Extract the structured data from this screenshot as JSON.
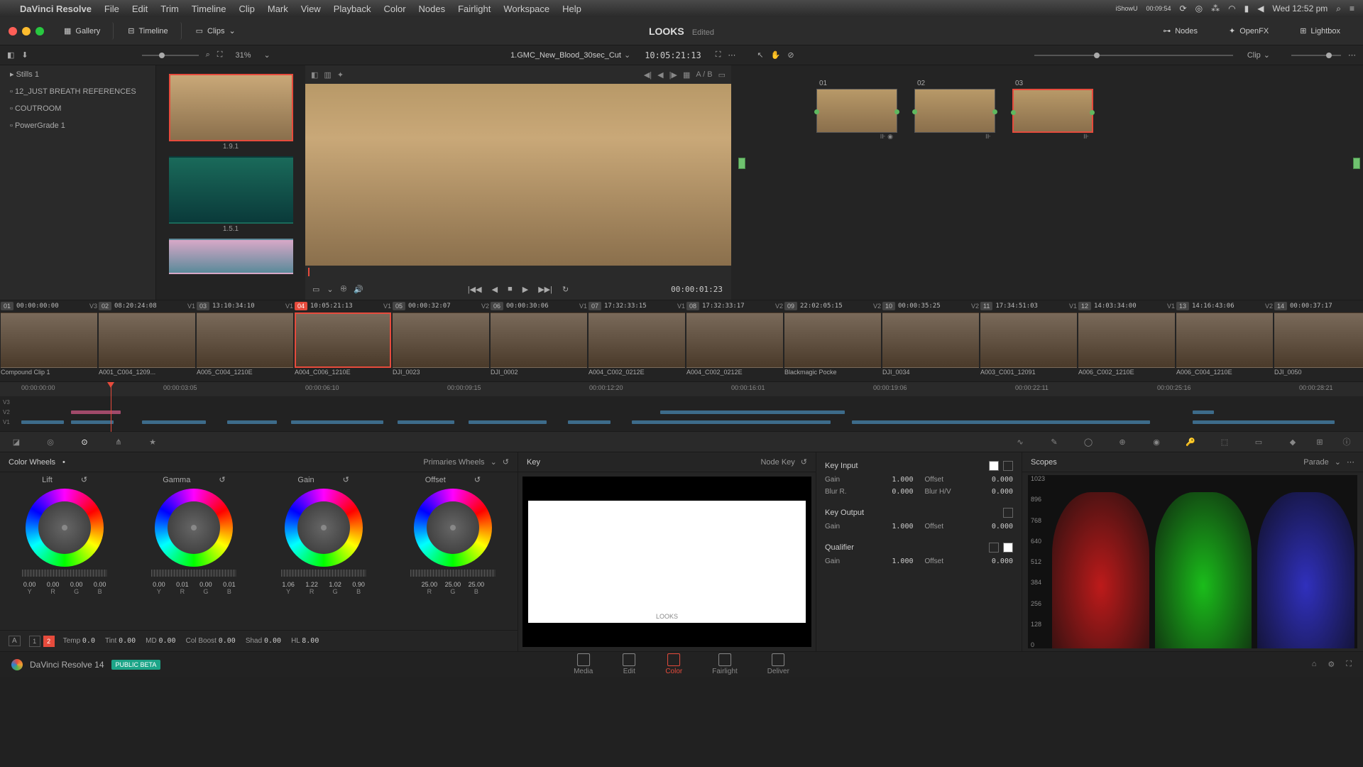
{
  "mac_menu": {
    "app": "DaVinci Resolve",
    "items": [
      "File",
      "Edit",
      "Trim",
      "Timeline",
      "Clip",
      "Mark",
      "View",
      "Playback",
      "Color",
      "Nodes",
      "Fairlight",
      "Workspace",
      "Help"
    ],
    "clock": "Wed 12:52 pm",
    "rec_app": "iShowU",
    "rec_time": "00:09:54"
  },
  "toolbar": {
    "gallery": "Gallery",
    "timeline": "Timeline",
    "clips": "Clips",
    "project": "LOOKS",
    "status": "Edited",
    "nodes": "Nodes",
    "openfx": "OpenFX",
    "lightbox": "Lightbox"
  },
  "subbar": {
    "zoom": "31%",
    "clip": "1.GMC_New_Blood_30sec_Cut",
    "timecode": "10:05:21:13",
    "ab": "A / B",
    "mode": "Clip"
  },
  "gallery_folders": [
    "Stills 1",
    "12_JUST BREATH REFERENCES",
    "COUTROOM",
    "PowerGrade 1"
  ],
  "stills": [
    {
      "label": "1.9.1",
      "selected": true
    },
    {
      "label": "1.5.1",
      "selected": false
    },
    {
      "label": "",
      "selected": false
    }
  ],
  "viewer": {
    "tc": "00:00:01:23"
  },
  "nodes": [
    {
      "num": "01",
      "sel": false
    },
    {
      "num": "02",
      "sel": false
    },
    {
      "num": "03",
      "sel": true
    }
  ],
  "clips": [
    {
      "num": "01",
      "tc": "00:00:00:00",
      "trk": "V3",
      "name": "Compound Clip 1",
      "active": false
    },
    {
      "num": "02",
      "tc": "08:20:24:08",
      "trk": "V1",
      "name": "A001_C004_1209...",
      "active": false
    },
    {
      "num": "03",
      "tc": "13:10:34:10",
      "trk": "V1",
      "name": "A005_C004_1210E",
      "active": false
    },
    {
      "num": "04",
      "tc": "10:05:21:13",
      "trk": "V1",
      "name": "A004_C006_1210E",
      "active": true
    },
    {
      "num": "05",
      "tc": "00:00:32:07",
      "trk": "V2",
      "name": "DJI_0023",
      "active": false
    },
    {
      "num": "06",
      "tc": "00:00:30:06",
      "trk": "V1",
      "name": "DJI_0002",
      "active": false
    },
    {
      "num": "07",
      "tc": "17:32:33:15",
      "trk": "V1",
      "name": "A004_C002_0212E",
      "active": false
    },
    {
      "num": "08",
      "tc": "17:32:33:17",
      "trk": "V2",
      "name": "A004_C002_0212E",
      "active": false
    },
    {
      "num": "09",
      "tc": "22:02:05:15",
      "trk": "V2",
      "name": "Blackmagic Pocke",
      "active": false
    },
    {
      "num": "10",
      "tc": "00:00:35:25",
      "trk": "V2",
      "name": "DJI_0034",
      "active": false
    },
    {
      "num": "11",
      "tc": "17:34:51:03",
      "trk": "V1",
      "name": "A003_C001_12091",
      "active": false
    },
    {
      "num": "12",
      "tc": "14:03:34:00",
      "trk": "V1",
      "name": "A006_C002_1210E",
      "active": false
    },
    {
      "num": "13",
      "tc": "14:16:43:06",
      "trk": "V2",
      "name": "A006_C004_1210E",
      "active": false
    },
    {
      "num": "14",
      "tc": "00:00:37:17",
      "trk": "V1",
      "name": "DJI_0050",
      "active": false
    }
  ],
  "timeline_ticks": [
    "00:00:00:00",
    "00:00:03:05",
    "00:00:06:10",
    "00:00:09:15",
    "00:00:12:20",
    "00:00:16:01",
    "00:00:19:06",
    "00:00:22:11",
    "00:00:25:16",
    "00:00:28:21"
  ],
  "tracks": [
    "V3",
    "V2",
    "V1"
  ],
  "wheels": {
    "title": "Color Wheels",
    "mode": "Primaries Wheels",
    "items": [
      {
        "name": "Lift",
        "vals": [
          "0.00",
          "0.00",
          "0.00",
          "0.00"
        ],
        "labs": [
          "Y",
          "R",
          "G",
          "B"
        ]
      },
      {
        "name": "Gamma",
        "vals": [
          "0.00",
          "0.01",
          "0.00",
          "0.01"
        ],
        "labs": [
          "Y",
          "R",
          "G",
          "B"
        ]
      },
      {
        "name": "Gain",
        "vals": [
          "1.06",
          "1.22",
          "1.02",
          "0.90"
        ],
        "labs": [
          "Y",
          "R",
          "G",
          "B"
        ]
      },
      {
        "name": "Offset",
        "vals": [
          "25.00",
          "25.00",
          "25.00"
        ],
        "labs": [
          "R",
          "G",
          "B"
        ]
      }
    ],
    "pages": [
      "1",
      "2"
    ],
    "globals": [
      {
        "l": "Temp",
        "v": "0.0"
      },
      {
        "l": "Tint",
        "v": "0.00"
      },
      {
        "l": "MD",
        "v": "0.00"
      },
      {
        "l": "Col Boost",
        "v": "0.00"
      },
      {
        "l": "Shad",
        "v": "0.00"
      },
      {
        "l": "HL",
        "v": "8.00"
      }
    ]
  },
  "key": {
    "title": "Key",
    "mode": "Node Key",
    "input": {
      "title": "Key Input",
      "rows": [
        {
          "l": "Gain",
          "v": "1.000"
        },
        {
          "l": "Offset",
          "v": "0.000"
        },
        {
          "l": "Blur R.",
          "v": "0.000"
        },
        {
          "l": "Blur H/V",
          "v": "0.000"
        }
      ]
    },
    "output": {
      "title": "Key Output",
      "rows": [
        {
          "l": "Gain",
          "v": "1.000"
        },
        {
          "l": "Offset",
          "v": "0.000"
        }
      ]
    },
    "qualifier": {
      "title": "Qualifier",
      "rows": [
        {
          "l": "Gain",
          "v": "1.000"
        },
        {
          "l": "Offset",
          "v": "0.000"
        }
      ]
    }
  },
  "scopes": {
    "title": "Scopes",
    "mode": "Parade",
    "scale": [
      "1023",
      "896",
      "768",
      "640",
      "512",
      "384",
      "256",
      "128",
      "0"
    ]
  },
  "pages": {
    "app": "DaVinci Resolve 14",
    "badge": "PUBLIC BETA",
    "items": [
      "Media",
      "Edit",
      "Color",
      "Fairlight",
      "Deliver"
    ],
    "active": 2
  }
}
